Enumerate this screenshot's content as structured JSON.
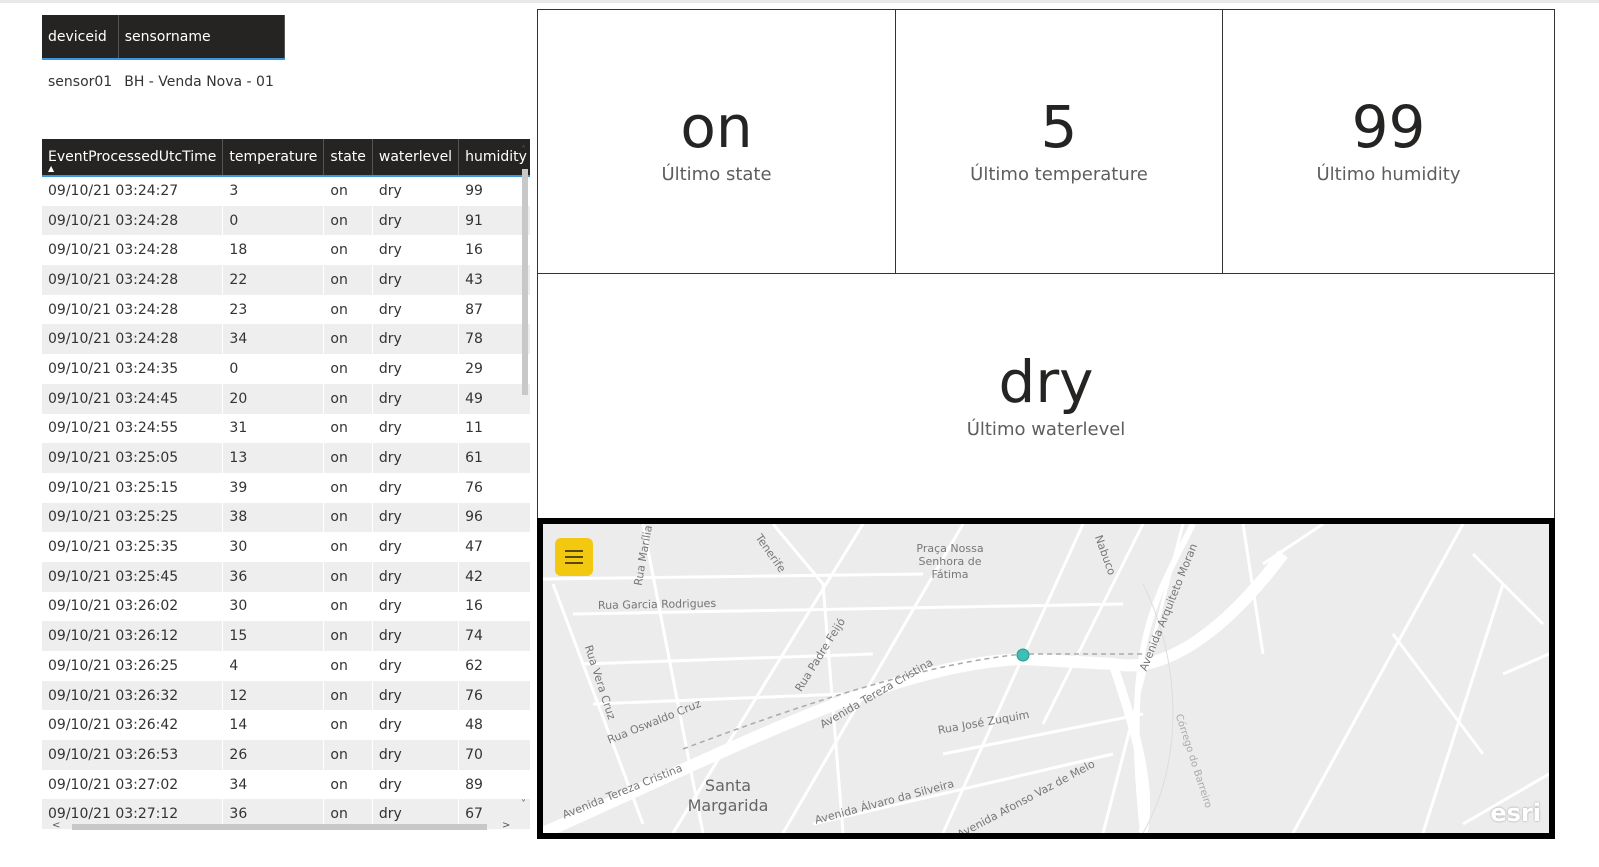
{
  "device_table": {
    "headers": [
      "deviceid",
      "sensorname"
    ],
    "rows": [
      [
        "sensor01",
        "BH - Venda Nova - 01"
      ]
    ]
  },
  "event_table": {
    "headers": [
      "EventProcessedUtcTime",
      "temperature",
      "state",
      "waterlevel",
      "humidity"
    ],
    "rows": [
      [
        "09/10/21 03:24:27",
        "3",
        "on",
        "dry",
        "99"
      ],
      [
        "09/10/21 03:24:28",
        "0",
        "on",
        "dry",
        "91"
      ],
      [
        "09/10/21 03:24:28",
        "18",
        "on",
        "dry",
        "16"
      ],
      [
        "09/10/21 03:24:28",
        "22",
        "on",
        "dry",
        "43"
      ],
      [
        "09/10/21 03:24:28",
        "23",
        "on",
        "dry",
        "87"
      ],
      [
        "09/10/21 03:24:28",
        "34",
        "on",
        "dry",
        "78"
      ],
      [
        "09/10/21 03:24:35",
        "0",
        "on",
        "dry",
        "29"
      ],
      [
        "09/10/21 03:24:45",
        "20",
        "on",
        "dry",
        "49"
      ],
      [
        "09/10/21 03:24:55",
        "31",
        "on",
        "dry",
        "11"
      ],
      [
        "09/10/21 03:25:05",
        "13",
        "on",
        "dry",
        "61"
      ],
      [
        "09/10/21 03:25:15",
        "39",
        "on",
        "dry",
        "76"
      ],
      [
        "09/10/21 03:25:25",
        "38",
        "on",
        "dry",
        "96"
      ],
      [
        "09/10/21 03:25:35",
        "30",
        "on",
        "dry",
        "47"
      ],
      [
        "09/10/21 03:25:45",
        "36",
        "on",
        "dry",
        "42"
      ],
      [
        "09/10/21 03:26:02",
        "30",
        "on",
        "dry",
        "16"
      ],
      [
        "09/10/21 03:26:12",
        "15",
        "on",
        "dry",
        "74"
      ],
      [
        "09/10/21 03:26:25",
        "4",
        "on",
        "dry",
        "62"
      ],
      [
        "09/10/21 03:26:32",
        "12",
        "on",
        "dry",
        "76"
      ],
      [
        "09/10/21 03:26:42",
        "14",
        "on",
        "dry",
        "48"
      ],
      [
        "09/10/21 03:26:53",
        "26",
        "on",
        "dry",
        "70"
      ],
      [
        "09/10/21 03:27:02",
        "34",
        "on",
        "dry",
        "89"
      ],
      [
        "09/10/21 03:27:12",
        "36",
        "on",
        "dry",
        "67"
      ]
    ]
  },
  "cards": {
    "state": {
      "value": "on",
      "label": "Último state"
    },
    "temperature": {
      "value": "5",
      "label": "Último temperature"
    },
    "humidity": {
      "value": "99",
      "label": "Último humidity"
    },
    "waterlevel": {
      "value": "dry",
      "label": "Último waterlevel"
    }
  },
  "map": {
    "labels": [
      "Praça Nossa Senhora de Fátima",
      "Rua Garcia Rodrigues",
      "Rua Vera Cruz",
      "Rua Padre Feijó",
      "Rua Oswaldo Cruz",
      "Avenida Tereza Cristina",
      "Avenida Tereza Cristina",
      "Rua José Zuquim",
      "Santa Margarida",
      "Avenida Álvaro da Silveira",
      "Avenida Afonso Vaz de Melo",
      "Avenida Arquiteto Moran",
      "Córrego do Barreiro",
      "Rua Marília",
      "Tenerife",
      "Nabuco"
    ],
    "attribution": "esri",
    "marker_color": "#3cbfb4",
    "menu_color": "#f2c811"
  }
}
